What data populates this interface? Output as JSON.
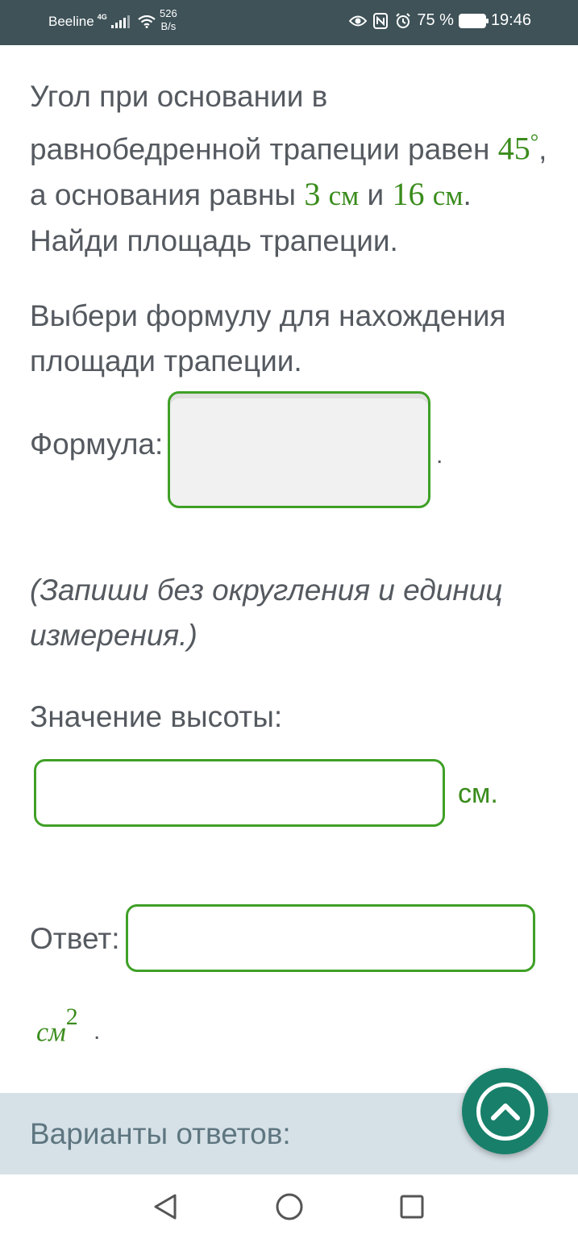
{
  "status_bar": {
    "carrier": "Beeline",
    "network_type": "4G",
    "speed_value": "526",
    "speed_unit": "B/s",
    "battery_percent": "75 %",
    "time": "19:46",
    "icons": [
      "signal-icon",
      "wifi-icon",
      "eye-icon",
      "nfc-icon",
      "alarm-icon",
      "battery-icon"
    ]
  },
  "problem": {
    "text_1": "Угол при основании в равнобедренной трапеции равен ",
    "angle": "45",
    "degree": "°",
    "text_2": ", а основания равны ",
    "base_1_value": "3",
    "base_1_unit": "см",
    "text_3": " и ",
    "base_2_value": "16",
    "base_2_unit": "см",
    "text_4": ". Найди площадь трапеции."
  },
  "prompt": "Выбери формулу для нахождения площади трапеции.",
  "formula": {
    "label": "Формула:",
    "trailing": "."
  },
  "note": "(Запиши без округления и единиц измерения.)",
  "height": {
    "label": "Значение высоты:",
    "value": "",
    "unit": "см."
  },
  "answer": {
    "label": "Ответ:",
    "value": "",
    "unit": "см",
    "unit_power": "2",
    "trailing": "."
  },
  "variants": {
    "label": "Варианты ответов:"
  },
  "colors": {
    "status_bar_bg": "#3e5258",
    "accent_green": "#3a8c1c",
    "input_border": "#3fa026",
    "variants_bg": "#d6e1e7",
    "scroll_button": "#18806a"
  },
  "navigation": {
    "icons": [
      "back-icon",
      "home-icon",
      "recents-icon"
    ]
  }
}
